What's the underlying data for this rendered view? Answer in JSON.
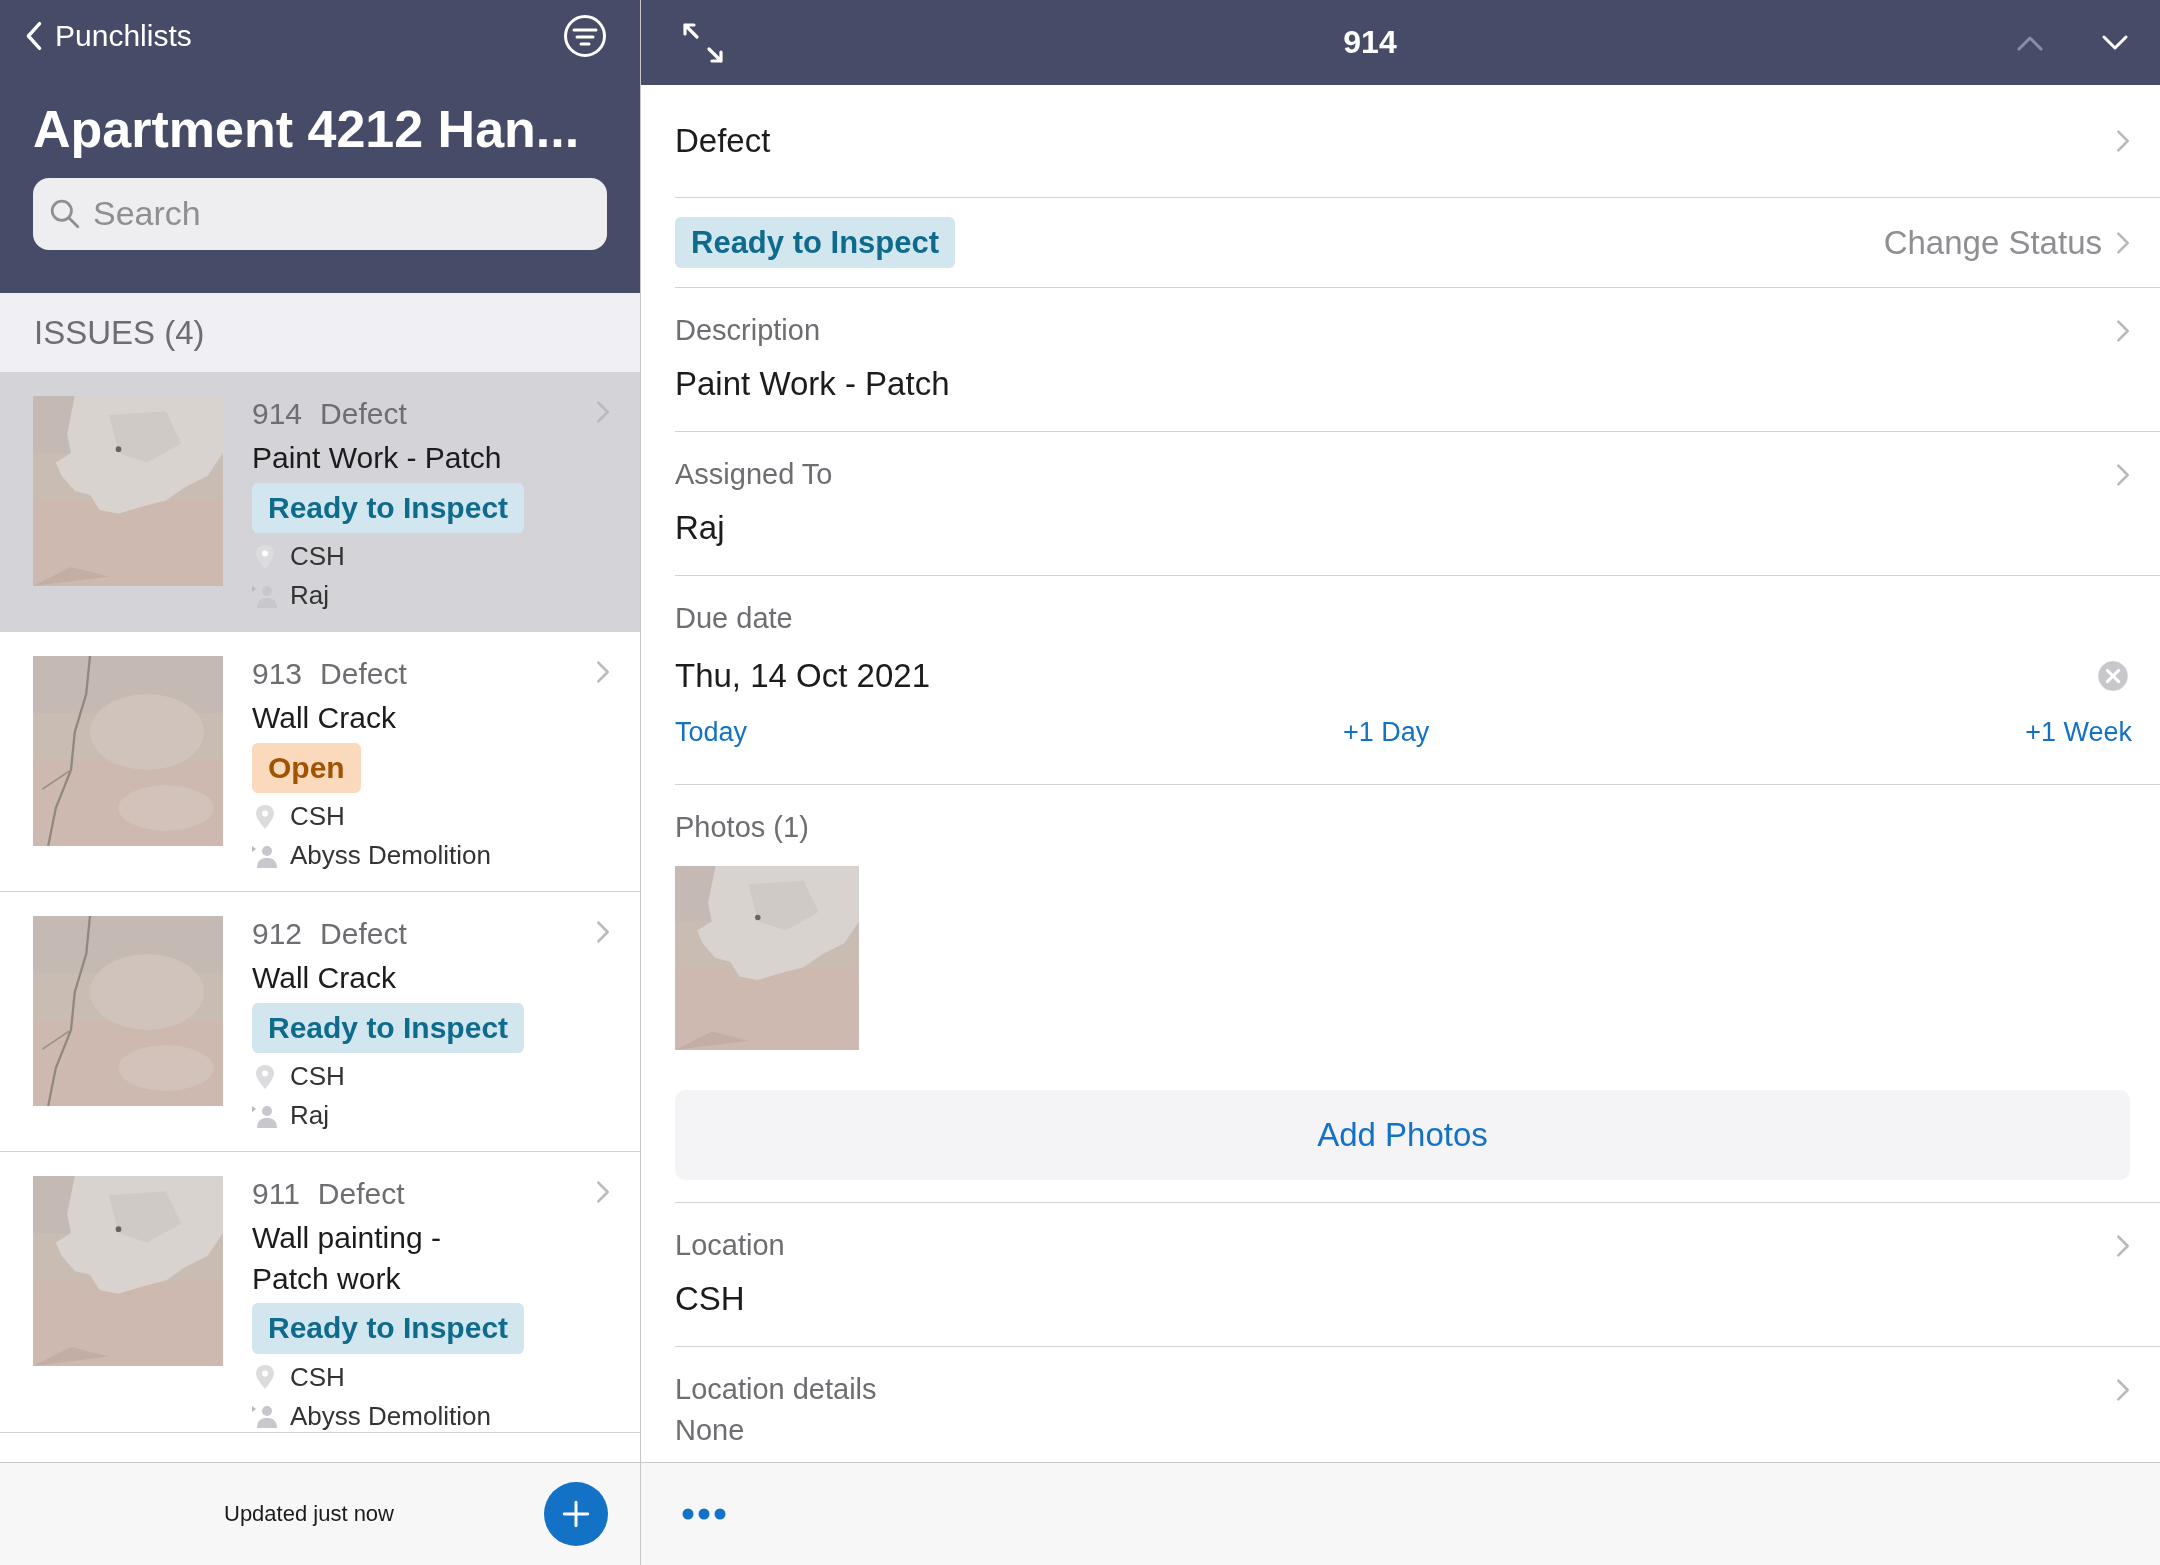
{
  "list_pane": {
    "back": "Punchlists",
    "title": "Apartment 4212 Han...",
    "search": {
      "placeholder": "Search"
    },
    "section": "ISSUES (4)",
    "issues": [
      {
        "number": "914",
        "type": "Defect",
        "title": "Paint Work - Patch",
        "status": {
          "label": "Ready to Inspect",
          "kind": "ready"
        },
        "location": "CSH",
        "assignee": "Raj",
        "selected": true
      },
      {
        "number": "913",
        "type": "Defect",
        "title": "Wall Crack",
        "status": {
          "label": "Open",
          "kind": "open"
        },
        "location": "CSH",
        "assignee": "Abyss Demolition",
        "selected": false
      },
      {
        "number": "912",
        "type": "Defect",
        "title": "Wall Crack",
        "status": {
          "label": "Ready to Inspect",
          "kind": "ready"
        },
        "location": "CSH",
        "assignee": "Raj",
        "selected": false
      },
      {
        "number": "911",
        "type": "Defect",
        "title": "Wall painting - Patch work",
        "status": {
          "label": "Ready to Inspect",
          "kind": "ready"
        },
        "location": "CSH",
        "assignee": "Abyss Demolition",
        "selected": false
      }
    ],
    "footer": {
      "updated": "Updated just now"
    }
  },
  "detail_pane": {
    "title": "914",
    "previous_disabled": true,
    "next_disabled": false,
    "type": "Defect",
    "status": {
      "label": "Ready to Inspect",
      "kind": "ready"
    },
    "change_status": "Change Status",
    "description": {
      "label": "Description",
      "value": "Paint Work - Patch"
    },
    "assigned_to": {
      "label": "Assigned To",
      "value": "Raj"
    },
    "due_date": {
      "label": "Due date",
      "value": "Thu, 14 Oct 2021",
      "shortcuts": [
        "Today",
        "+1 Day",
        "+1 Week"
      ]
    },
    "photos": {
      "label": "Photos (1)",
      "add": "Add Photos"
    },
    "location": {
      "label": "Location",
      "value": "CSH"
    },
    "location_details": {
      "label": "Location details",
      "value": "None"
    }
  }
}
